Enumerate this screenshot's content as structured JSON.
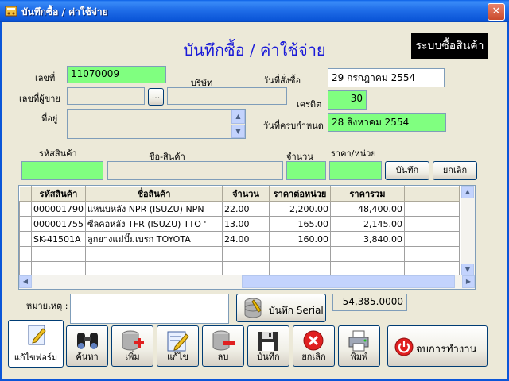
{
  "window": {
    "title": "บันทึกซื้อ / ค่าใช้จ่าย",
    "close_glyph": "✕"
  },
  "header": {
    "heading": "บันทึกซื้อ / ค่าใช้จ่าย",
    "system_label": "ระบบซื้อสินค้า"
  },
  "form": {
    "doc_no_label": "เลขที่",
    "doc_no": "11070009",
    "supplier_no_label": "เลขที่ผู้ขาย",
    "supplier_no": "",
    "browse_label": "...",
    "company_label": "บริษัท",
    "company": "",
    "address_label": "ที่อยู่",
    "address": "",
    "order_date_label": "วันที่สั่งซื้อ",
    "order_date": "29 กรกฎาคม 2554",
    "credit_label": "เครดิต",
    "credit": "30",
    "due_date_label": "วันที่ครบกำหนด",
    "due_date": "28 สิงหาคม 2554"
  },
  "entry": {
    "code_label": "รหัสสินค้า",
    "name_label": "ชื่อ-สินค้า",
    "qty_label": "จำนวน",
    "price_label": "ราคา/หน่วย",
    "code": "",
    "name": "",
    "qty": "",
    "price": "",
    "save_label": "บันทึก",
    "cancel_label": "ยกเลิก"
  },
  "grid": {
    "headers": [
      "รหัสสินค้า",
      "ชื่อสินค้า",
      "จำนวน",
      "ราคาต่อหน่วย",
      "ราคารวม"
    ],
    "rows": [
      [
        "000001790",
        "แหนบหลัง  NPR (ISUZU) NPN",
        "22.00",
        "2,200.00",
        "48,400.00"
      ],
      [
        "000001755",
        "ซีลคอหลัง  TFR (ISUZU) TTO '",
        "13.00",
        "165.00",
        "2,145.00"
      ],
      [
        "SK-41501A",
        "ลูกยางแม่ปั๊มเบรก  TOYOTA",
        "24.00",
        "160.00",
        "3,840.00"
      ]
    ]
  },
  "footer": {
    "note_label": "หมายเหตุ :",
    "note": "",
    "serial_label": "บันทึก Serial",
    "total": "54,385.0000"
  },
  "toolbar": {
    "edit_form": "แก้ไขฟอร์ม",
    "search": "ค้นหา",
    "add": "เพิ่ม",
    "edit": "แก้ไข",
    "delete": "ลบ",
    "save": "บันทึก",
    "cancel": "ยกเลิก",
    "print": "พิมพ์",
    "exit": "จบการทำงาน"
  },
  "colors": {
    "title_bar": "#0B56D8",
    "heading": "#1A1AD8",
    "field_green": "#80FF80",
    "exit_red": "#E02020"
  }
}
